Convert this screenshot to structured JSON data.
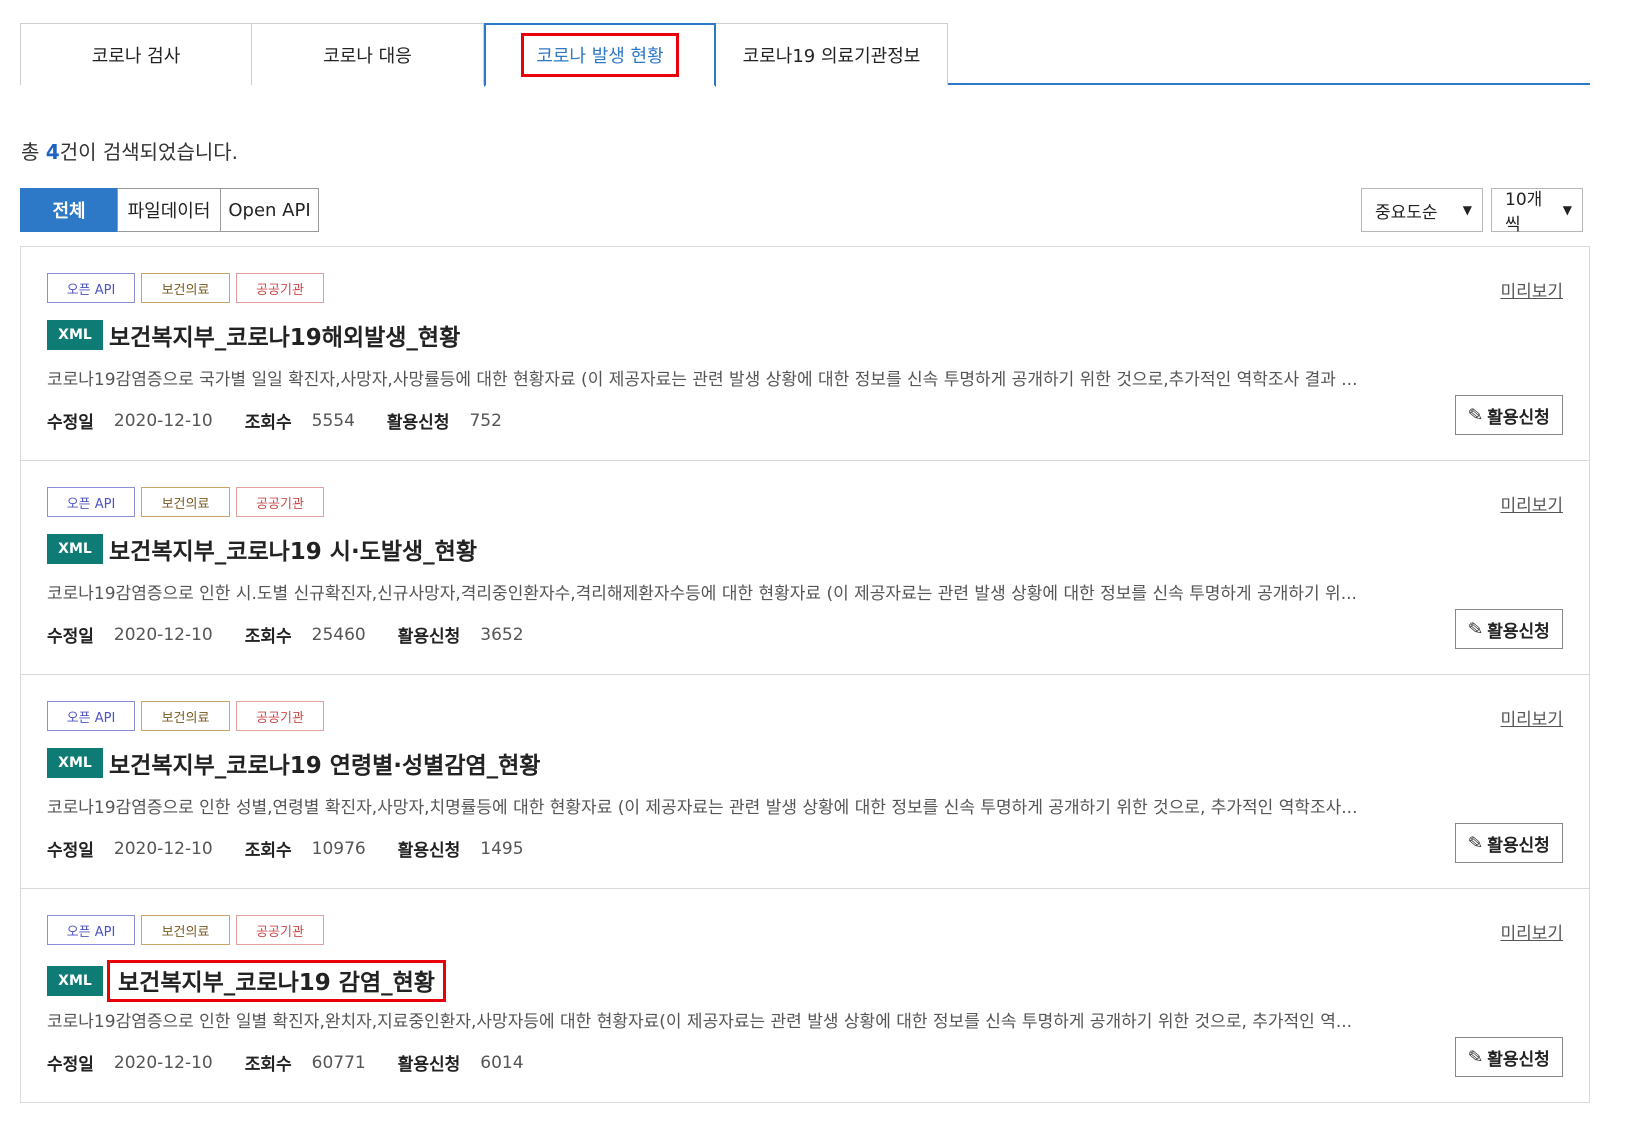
{
  "tabs": [
    {
      "label": "코로나 검사"
    },
    {
      "label": "코로나 대응"
    },
    {
      "label": "코로나 발생 현황"
    },
    {
      "label": "코로나19 의료기관정보"
    }
  ],
  "result": {
    "prefix": "총 ",
    "count": "4",
    "suffix": "건이 검색되었습니다."
  },
  "filters": [
    {
      "label": "전체"
    },
    {
      "label": "파일데이터"
    },
    {
      "label": "Open API"
    }
  ],
  "sort": {
    "selected": "중요도순"
  },
  "page_size": {
    "selected": "10개씩"
  },
  "items": [
    {
      "tags": [
        "오픈 API",
        "보건의료",
        "공공기관"
      ],
      "preview": "미리보기",
      "badge": "XML",
      "title": "보건복지부_코로나19해외발생_현황",
      "desc": "코로나19감염증으로 국가별 일일 확진자,사망자,사망률등에 대한 현황자료 (이 제공자료는 관련 발생 상황에 대한 정보를 신속 투명하게 공개하기 위한 것으로,추가적인 역학조사 결과 ...",
      "meta": {
        "modified_label": "수정일",
        "modified": "2020-12-10",
        "views_label": "조회수",
        "views": "5554",
        "apply_label": "활용신청",
        "apply": "752"
      },
      "apply_button": "활용신청"
    },
    {
      "tags": [
        "오픈 API",
        "보건의료",
        "공공기관"
      ],
      "preview": "미리보기",
      "badge": "XML",
      "title": "보건복지부_코로나19 시·도발생_현황",
      "desc": "코로나19감염증으로 인한 시.도별 신규확진자,신규사망자,격리중인환자수,격리해제환자수등에 대한 현황자료 (이 제공자료는 관련 발생 상황에 대한 정보를 신속 투명하게 공개하기 위...",
      "meta": {
        "modified_label": "수정일",
        "modified": "2020-12-10",
        "views_label": "조회수",
        "views": "25460",
        "apply_label": "활용신청",
        "apply": "3652"
      },
      "apply_button": "활용신청"
    },
    {
      "tags": [
        "오픈 API",
        "보건의료",
        "공공기관"
      ],
      "preview": "미리보기",
      "badge": "XML",
      "title": "보건복지부_코로나19 연령별·성별감염_현황",
      "desc": "코로나19감염증으로 인한 성별,연령별 확진자,사망자,치명률등에 대한 현황자료 (이 제공자료는 관련 발생 상황에 대한 정보를 신속 투명하게 공개하기 위한 것으로, 추가적인 역학조사...",
      "meta": {
        "modified_label": "수정일",
        "modified": "2020-12-10",
        "views_label": "조회수",
        "views": "10976",
        "apply_label": "활용신청",
        "apply": "1495"
      },
      "apply_button": "활용신청"
    },
    {
      "tags": [
        "오픈 API",
        "보건의료",
        "공공기관"
      ],
      "preview": "미리보기",
      "badge": "XML",
      "title": "보건복지부_코로나19 감염_현황",
      "desc": "코로나19감염증으로 인한 일별 확진자,완치자,지료중인환자,사망자등에 대한 현황자료(이 제공자료는 관련 발생 상황에 대한 정보를 신속 투명하게 공개하기 위한 것으로, 추가적인 역...",
      "meta": {
        "modified_label": "수정일",
        "modified": "2020-12-10",
        "views_label": "조회수",
        "views": "60771",
        "apply_label": "활용신청",
        "apply": "6014"
      },
      "apply_button": "활용신청"
    }
  ],
  "colors": {
    "accent": "#2e78c8",
    "highlight_box": "#e8000b",
    "xml_badge": "#0f7b75"
  }
}
